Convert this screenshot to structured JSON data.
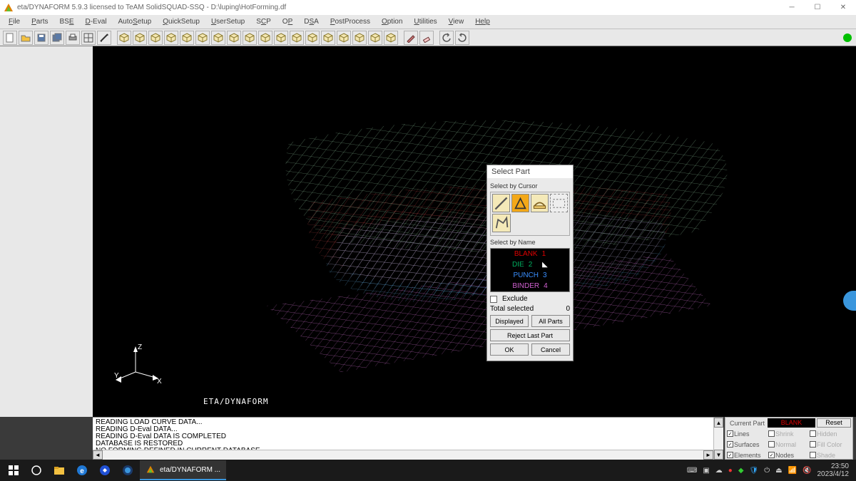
{
  "title": "eta/DYNAFORM 5.9.3 licensed to TeAM SolidSQUAD-SSQ - D:\\luping\\HotForming.df",
  "menu": [
    "File",
    "Parts",
    "BSE",
    "D-Eval",
    "AutoSetup",
    "QuickSetup",
    "UserSetup",
    "SCP",
    "OP",
    "DSA",
    "PostProcess",
    "Option",
    "Utilities",
    "View",
    "Help"
  ],
  "menu_underline_index": [
    0,
    0,
    2,
    0,
    4,
    0,
    0,
    1,
    1,
    1,
    0,
    0,
    0,
    0,
    0
  ],
  "watermark": "ETA/DYNAFORM",
  "axis": {
    "x": "X",
    "y": "Y",
    "z": "Z"
  },
  "console_lines": [
    "READING LOAD CURVE DATA...",
    "READING D-Eval DATA...",
    "READING D-Eval DATA IS COMPLETED",
    "DATABASE IS RESTORED",
    "NO FORMING DEFINED IN CURRENT DATABASE"
  ],
  "dialog": {
    "title": "Select Part",
    "group1": "Select by Cursor",
    "group2": "Select by Name",
    "exclude": "Exclude",
    "total_label": "Total selected",
    "total_value": "0",
    "btn_displayed": "Displayed",
    "btn_allparts": "All Parts",
    "btn_reject": "Reject Last Part",
    "btn_ok": "OK",
    "btn_cancel": "Cancel",
    "parts": [
      {
        "name": "BLANK",
        "id": "1",
        "color": "#e00000"
      },
      {
        "name": "DIE",
        "id": "2",
        "color": "#00b060"
      },
      {
        "name": "PUNCH",
        "id": "3",
        "color": "#3a8fff"
      },
      {
        "name": "BINDER",
        "id": "4",
        "color": "#d060d0"
      }
    ]
  },
  "rpanel": {
    "current_part_label": "Current Part",
    "current_part": "BLANK",
    "reset": "Reset",
    "opts": [
      {
        "l": "Lines",
        "on": true
      },
      {
        "l": "Shrink",
        "on": false
      },
      {
        "l": "Hidden",
        "on": false
      },
      {
        "l": "Surfaces",
        "on": true
      },
      {
        "l": "Normal",
        "on": false
      },
      {
        "l": "Fill Color",
        "on": false
      },
      {
        "l": "Elements",
        "on": true
      },
      {
        "l": "Nodes",
        "on": true
      },
      {
        "l": "Shade",
        "on": false
      }
    ]
  },
  "taskbar": {
    "app": "eta/DYNAFORM ...",
    "time": "23:50",
    "date": "2023/4/12"
  }
}
